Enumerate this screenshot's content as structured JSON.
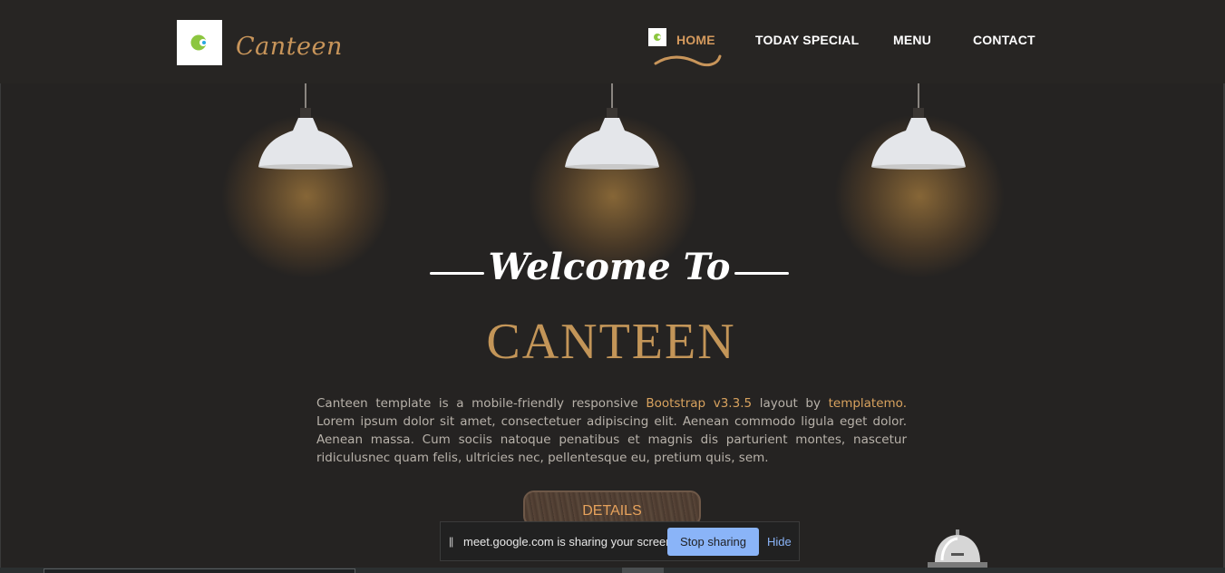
{
  "header": {
    "logo_text": "Canteen",
    "nav": [
      {
        "label": "HOME",
        "active": true
      },
      {
        "label": "TODAY SPECIAL",
        "active": false
      },
      {
        "label": "MENU",
        "active": false
      },
      {
        "label": "CONTACT",
        "active": false
      }
    ]
  },
  "hero": {
    "welcome": "Welcome To",
    "brand": "CANTEEN",
    "description_parts": {
      "p1": "Canteen template is a mobile-friendly responsive ",
      "link1": "Bootstrap v3.3.5",
      "p2": " layout by ",
      "link2": "templatemo.",
      "p3": " Lorem ipsum dolor sit amet, consectetuer adipiscing elit. Aenean commodo ligula eget dolor. Aenean massa. Cum sociis natoque penatibus et magnis dis parturient montes, nascetur ridiculusnec quam felis, ultricies nec, pellentesque eu, pretium quis, sem."
    },
    "details_button": "DETAILS"
  },
  "share_bar": {
    "pause_glyph": "||",
    "message": "meet.google.com is sharing your screen.",
    "stop_label": "Stop sharing",
    "hide_label": "Hide"
  },
  "colors": {
    "background": "#252322",
    "accent": "#c39558",
    "link": "#d8a25e",
    "logo_green": "#8cc63f",
    "share_button": "#8ab4f8"
  },
  "icons": {
    "logo": "canteen-c-logo-icon",
    "home_nav": "canteen-c-logo-icon",
    "lamp": "pendant-lamp-icon",
    "bell": "service-bell-icon"
  }
}
